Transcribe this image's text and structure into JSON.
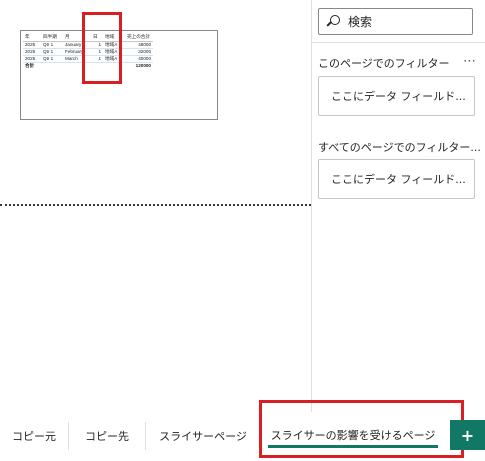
{
  "visual": {
    "headers": [
      "年",
      "四半期",
      "月",
      "日",
      "地域",
      "売上の合計"
    ],
    "rows": [
      [
        "2025",
        "Qtr 1",
        "January",
        "1",
        "地域A",
        "48000"
      ],
      [
        "2025",
        "Qtr 1",
        "February",
        "1",
        "地域A",
        "32000"
      ],
      [
        "2025",
        "Qtr 1",
        "March",
        "1",
        "地域A",
        "40000"
      ]
    ],
    "total": [
      "合計",
      "",
      "",
      "",
      "",
      "120000"
    ]
  },
  "filter_pane": {
    "search_placeholder": "検索",
    "page_filters_title": "このページでのフィルター",
    "page_filters_well": "ここにデータ フィールド...",
    "all_pages_title": "すべてのページでのフィルター...",
    "all_pages_well": "ここにデータ フィールド...",
    "more_icon": "more-options-icon"
  },
  "tabs": [
    {
      "label": "コピー元"
    },
    {
      "label": "コピー先"
    },
    {
      "label": "スライサーページ"
    },
    {
      "label": "スライサーの影響を受けるページ",
      "active": true
    }
  ],
  "add_page": {
    "icon": "plus-icon",
    "glyph": "+"
  },
  "colors": {
    "accent": "#117865",
    "highlight_box": "#d91e24"
  }
}
